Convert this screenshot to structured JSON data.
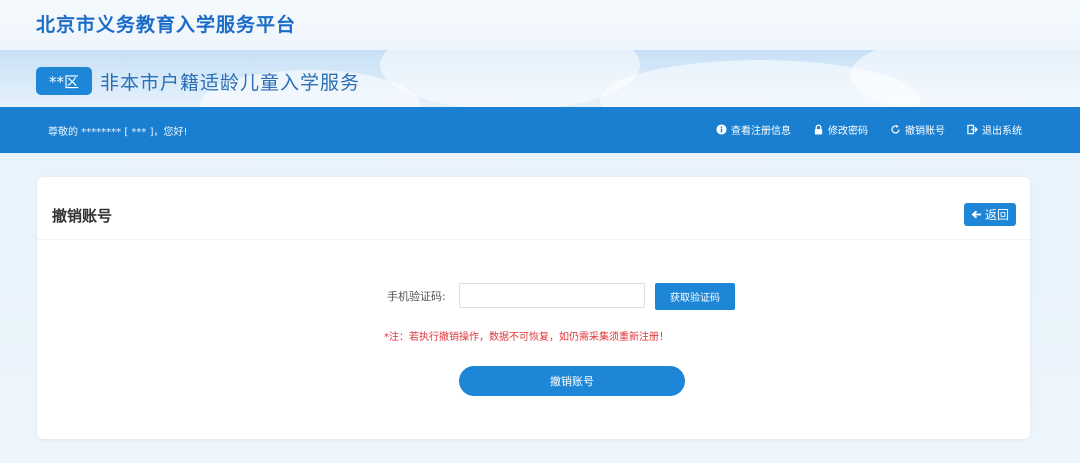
{
  "header": {
    "site_title": "北京市义务教育入学服务平台",
    "district_badge": "**区",
    "service_title": "非本市户籍适龄儿童入学服务"
  },
  "navbar": {
    "greeting": "尊敬的 ******** [ *** ]，您好!",
    "links": [
      {
        "icon": "info-icon",
        "label": "查看注册信息"
      },
      {
        "icon": "lock-icon",
        "label": "修改密码"
      },
      {
        "icon": "refresh-icon",
        "label": "撤销账号"
      },
      {
        "icon": "logout-icon",
        "label": "退出系统"
      }
    ]
  },
  "main": {
    "title": "撤销账号",
    "back_label": "返回",
    "code_field_label": "手机验证码:",
    "code_input_value": "",
    "get_code_label": "获取验证码",
    "warning": "*注：若执行撤销操作，数据不可恢复，如仍需采集须重新注册！",
    "cancel_account_label": "撤销账号"
  },
  "colors": {
    "primary": "#1e86d6",
    "navbar": "#1a7fd1",
    "title": "#1a6cc8",
    "warning": "#e0353b"
  }
}
